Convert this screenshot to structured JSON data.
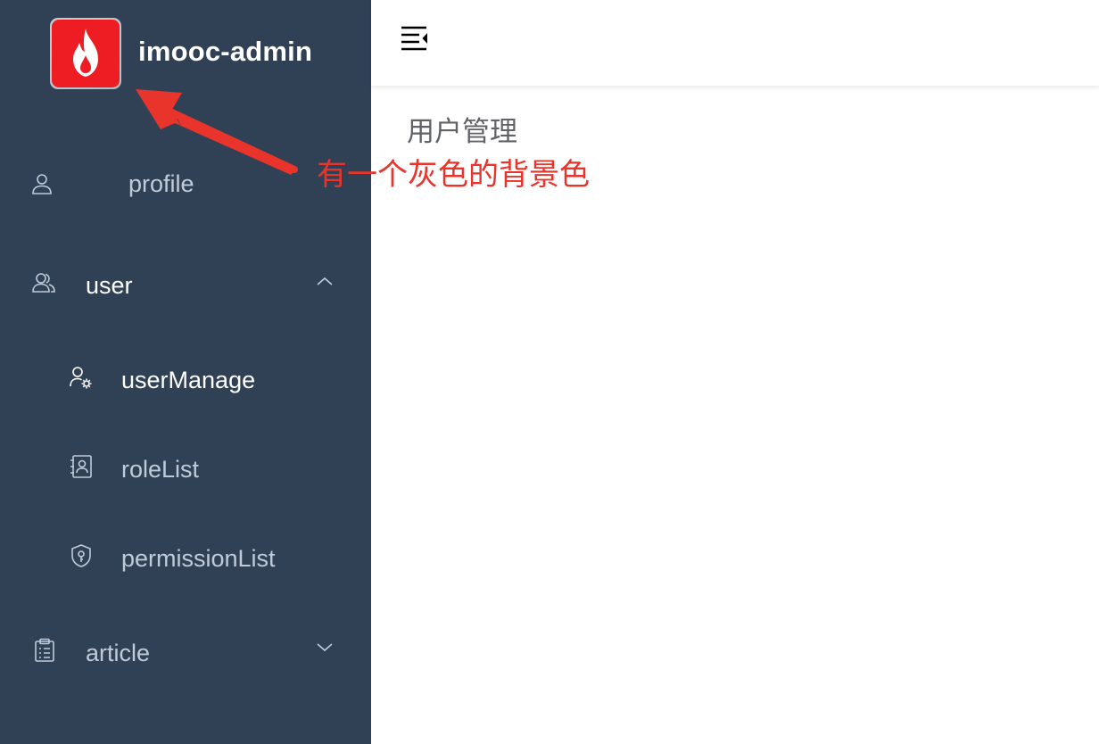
{
  "sidebar": {
    "logo_title": "imooc-admin",
    "items": [
      {
        "label": "profile",
        "icon": "user-icon"
      },
      {
        "label": "user",
        "icon": "users-icon",
        "expanded": true
      },
      {
        "label": "userManage",
        "icon": "user-manage-icon",
        "active": true
      },
      {
        "label": "roleList",
        "icon": "role-list-icon"
      },
      {
        "label": "permissionList",
        "icon": "permission-shield-icon"
      },
      {
        "label": "article",
        "icon": "clipboard-icon",
        "expanded": false
      }
    ]
  },
  "navbar": {
    "hamburger_icon": "menu-fold-icon"
  },
  "main": {
    "content_text": "用户管理"
  },
  "annotation": {
    "text": "有一个灰色的背景色",
    "color": "#e8342b"
  },
  "colors": {
    "sidebar_bg": "#304156",
    "sidebar_text": "#bfcbd9",
    "logo_red": "#ee1d24"
  }
}
